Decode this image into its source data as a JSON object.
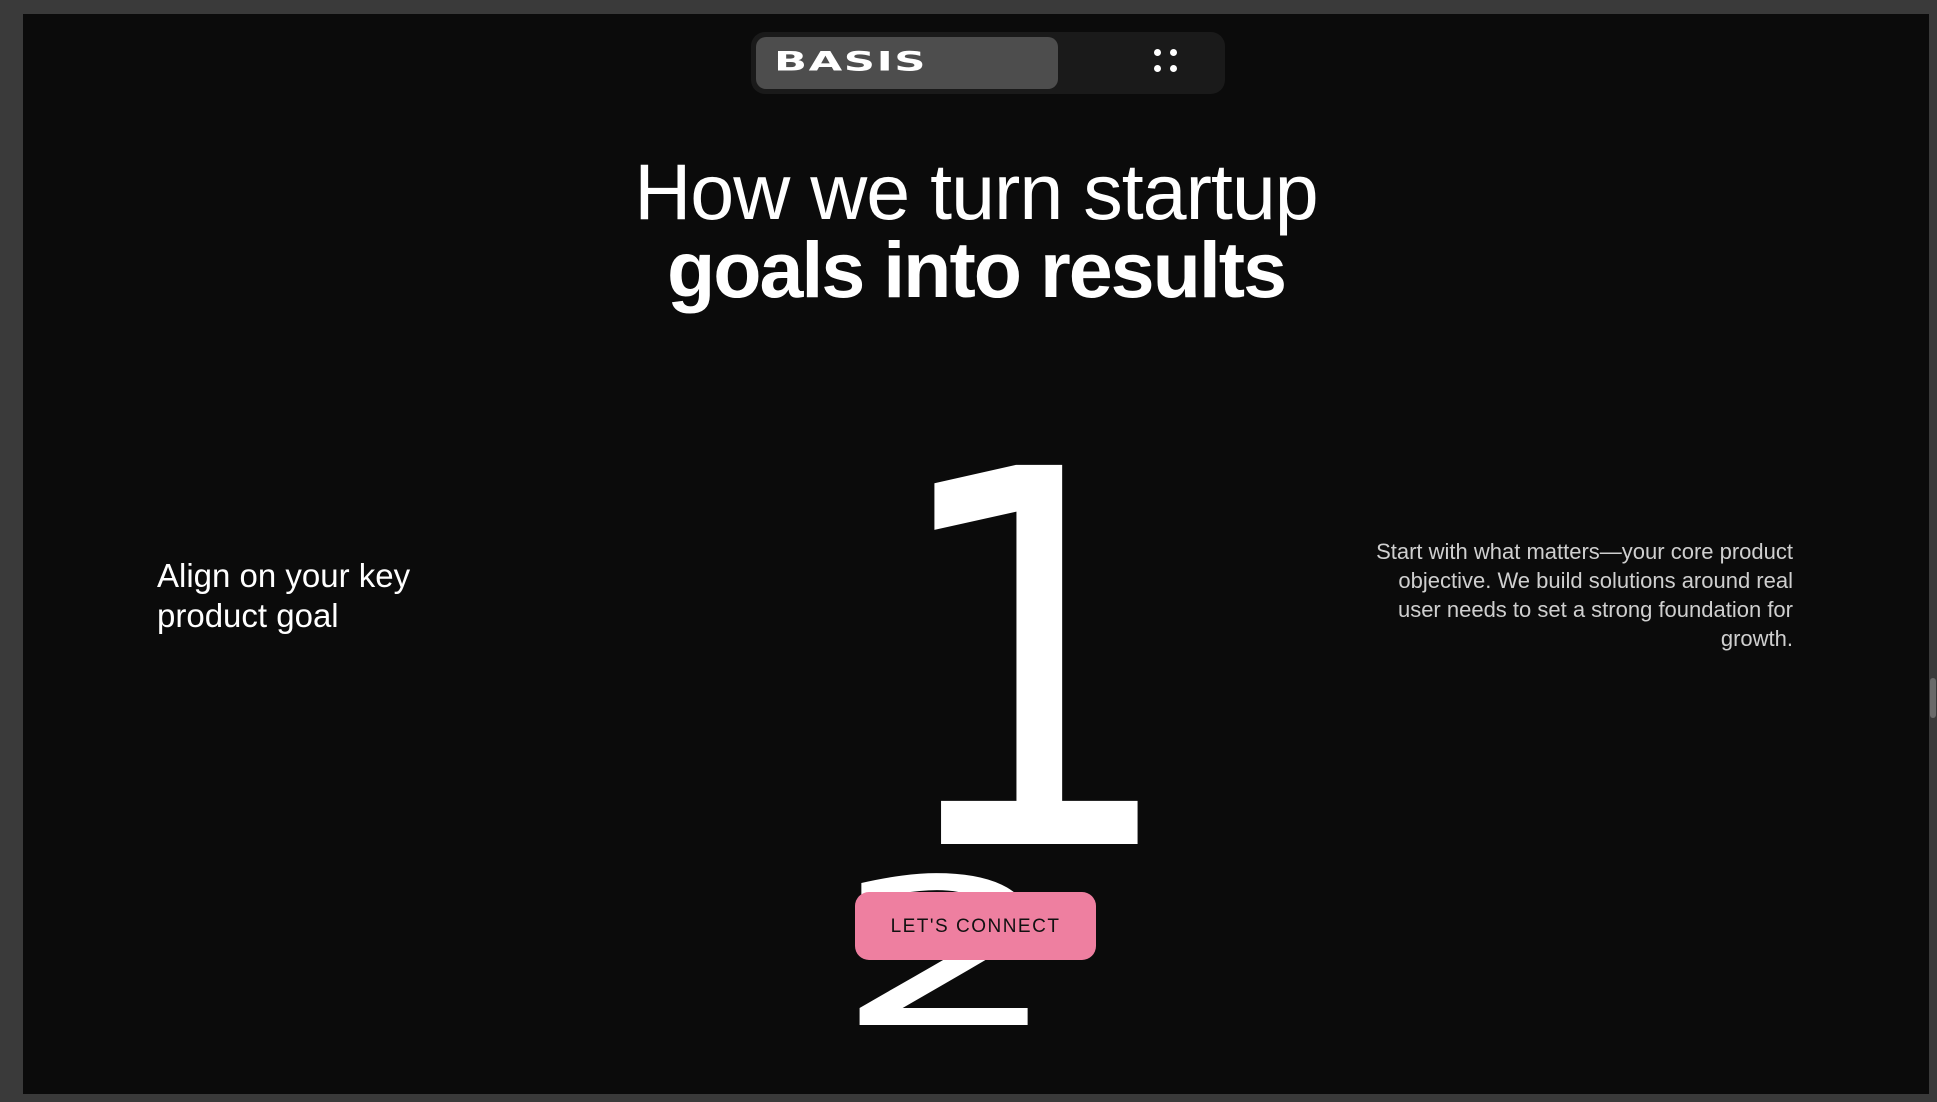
{
  "nav": {
    "logo": "BASIS",
    "menu_icon": "grid-dots-icon"
  },
  "headline": {
    "line1": "How we turn startup",
    "line2": "goals into results"
  },
  "step": {
    "number": "1",
    "next_number": "2",
    "title": "Align on your key product goal",
    "description": "Start with what matters—your core product objective. We build solutions around real user needs to set a strong foundation for growth."
  },
  "cta": {
    "label": "LET'S CONNECT"
  },
  "colors": {
    "background": "#0b0b0b",
    "accent": "#ee7fa0",
    "text": "#ffffff"
  }
}
